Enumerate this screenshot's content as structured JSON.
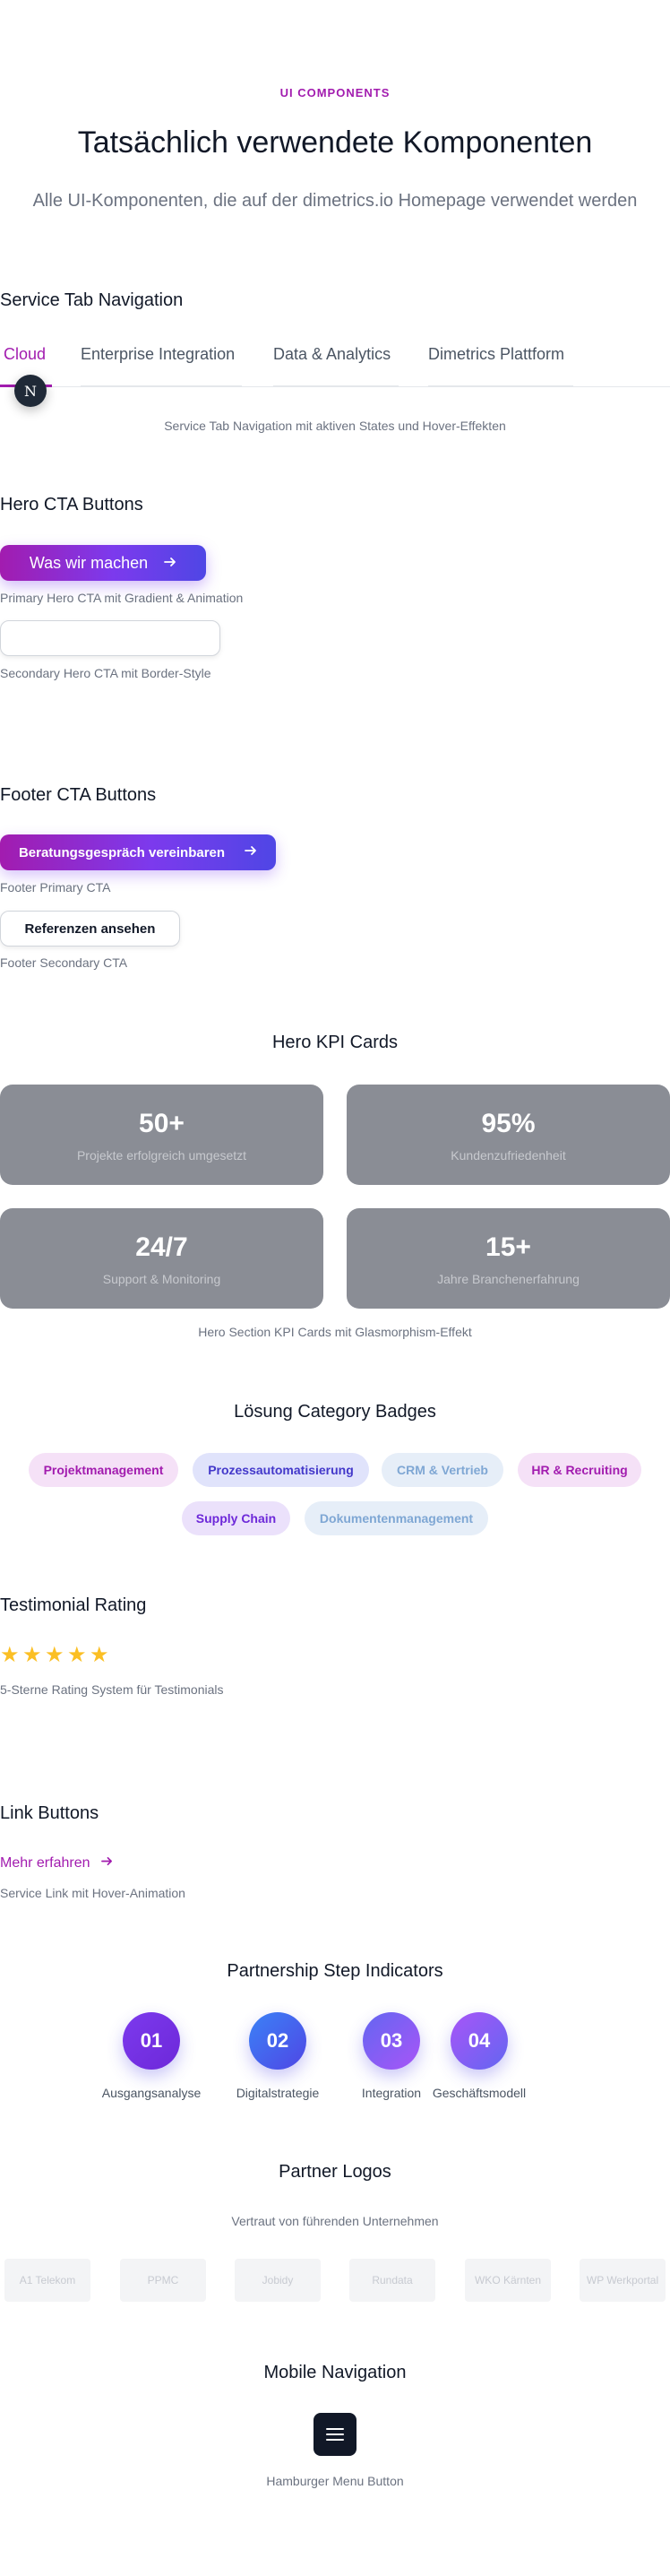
{
  "header": {
    "eyebrow": "UI COMPONENTS",
    "title": "Tatsächlich verwendete Komponenten",
    "subtitle": "Alle UI-Komponenten, die auf der dimetrics.io Homepage verwendet werden"
  },
  "service_tabs": {
    "heading": "Service Tab Navigation",
    "tabs": [
      {
        "label": "Cloud",
        "active": true
      },
      {
        "label": "Enterprise Integration",
        "active": false
      },
      {
        "label": "Data & Analytics",
        "active": false
      },
      {
        "label": "Dimetrics Plattform",
        "active": false
      }
    ],
    "badge_letter": "N",
    "caption": "Service Tab Navigation mit aktiven States und Hover-Effekten"
  },
  "hero_cta": {
    "heading": "Hero CTA Buttons",
    "primary_label": "Was wir machen",
    "primary_caption": "Primary Hero CTA mit Gradient & Animation",
    "secondary_label": "",
    "secondary_caption": "Secondary Hero CTA mit Border-Style"
  },
  "footer_cta": {
    "heading": "Footer CTA Buttons",
    "primary_label": "Beratungsgespräch vereinbaren",
    "primary_caption": "Footer Primary CTA",
    "secondary_label": "Referenzen ansehen",
    "secondary_caption": "Footer Secondary CTA"
  },
  "kpi": {
    "heading": "Hero KPI Cards",
    "cards": [
      {
        "value": "50+",
        "label": "Projekte erfolgreich umgesetzt"
      },
      {
        "value": "95%",
        "label": "Kundenzufriedenheit"
      },
      {
        "value": "24/7",
        "label": "Support & Monitoring"
      },
      {
        "value": "15+",
        "label": "Jahre Branchenerfahrung"
      }
    ],
    "caption": "Hero Section KPI Cards mit Glasmorphism-Effekt"
  },
  "badges": {
    "heading": "Lösung Category Badges",
    "items": [
      {
        "label": "Projektmanagement"
      },
      {
        "label": "Prozessautomatisierung"
      },
      {
        "label": "CRM & Vertrieb"
      },
      {
        "label": "HR & Recruiting"
      },
      {
        "label": "Supply Chain"
      },
      {
        "label": "Dokumentenmanagement"
      }
    ]
  },
  "rating": {
    "heading": "Testimonial Rating",
    "stars": 5,
    "caption": "5-Sterne Rating System für Testimonials"
  },
  "links": {
    "heading": "Link Buttons",
    "label": "Mehr erfahren",
    "caption": "Service Link mit Hover-Animation"
  },
  "steps": {
    "heading": "Partnership Step Indicators",
    "items": [
      {
        "number": "01",
        "label": "Ausgangsanalyse"
      },
      {
        "number": "02",
        "label": "Digitalstrategie"
      },
      {
        "number": "03",
        "label": "Integration"
      },
      {
        "number": "04",
        "label": "Geschäftsmodell"
      }
    ]
  },
  "partners": {
    "heading": "Partner Logos",
    "subheading": "Vertraut von führenden Unternehmen",
    "logos": [
      "A1 Telekom",
      "PPMC",
      "Jobidy",
      "Rundata",
      "WKO Kärnten",
      "WP Werkportal"
    ]
  },
  "mobile_nav": {
    "heading": "Mobile Navigation",
    "caption": "Hamburger Menu Button"
  },
  "colors": {
    "accent": "#a21caf",
    "gradient_start": "#a21caf",
    "gradient_end": "#4f46e5",
    "star": "#fbbf24",
    "kpi_card": "#8a8d95"
  }
}
